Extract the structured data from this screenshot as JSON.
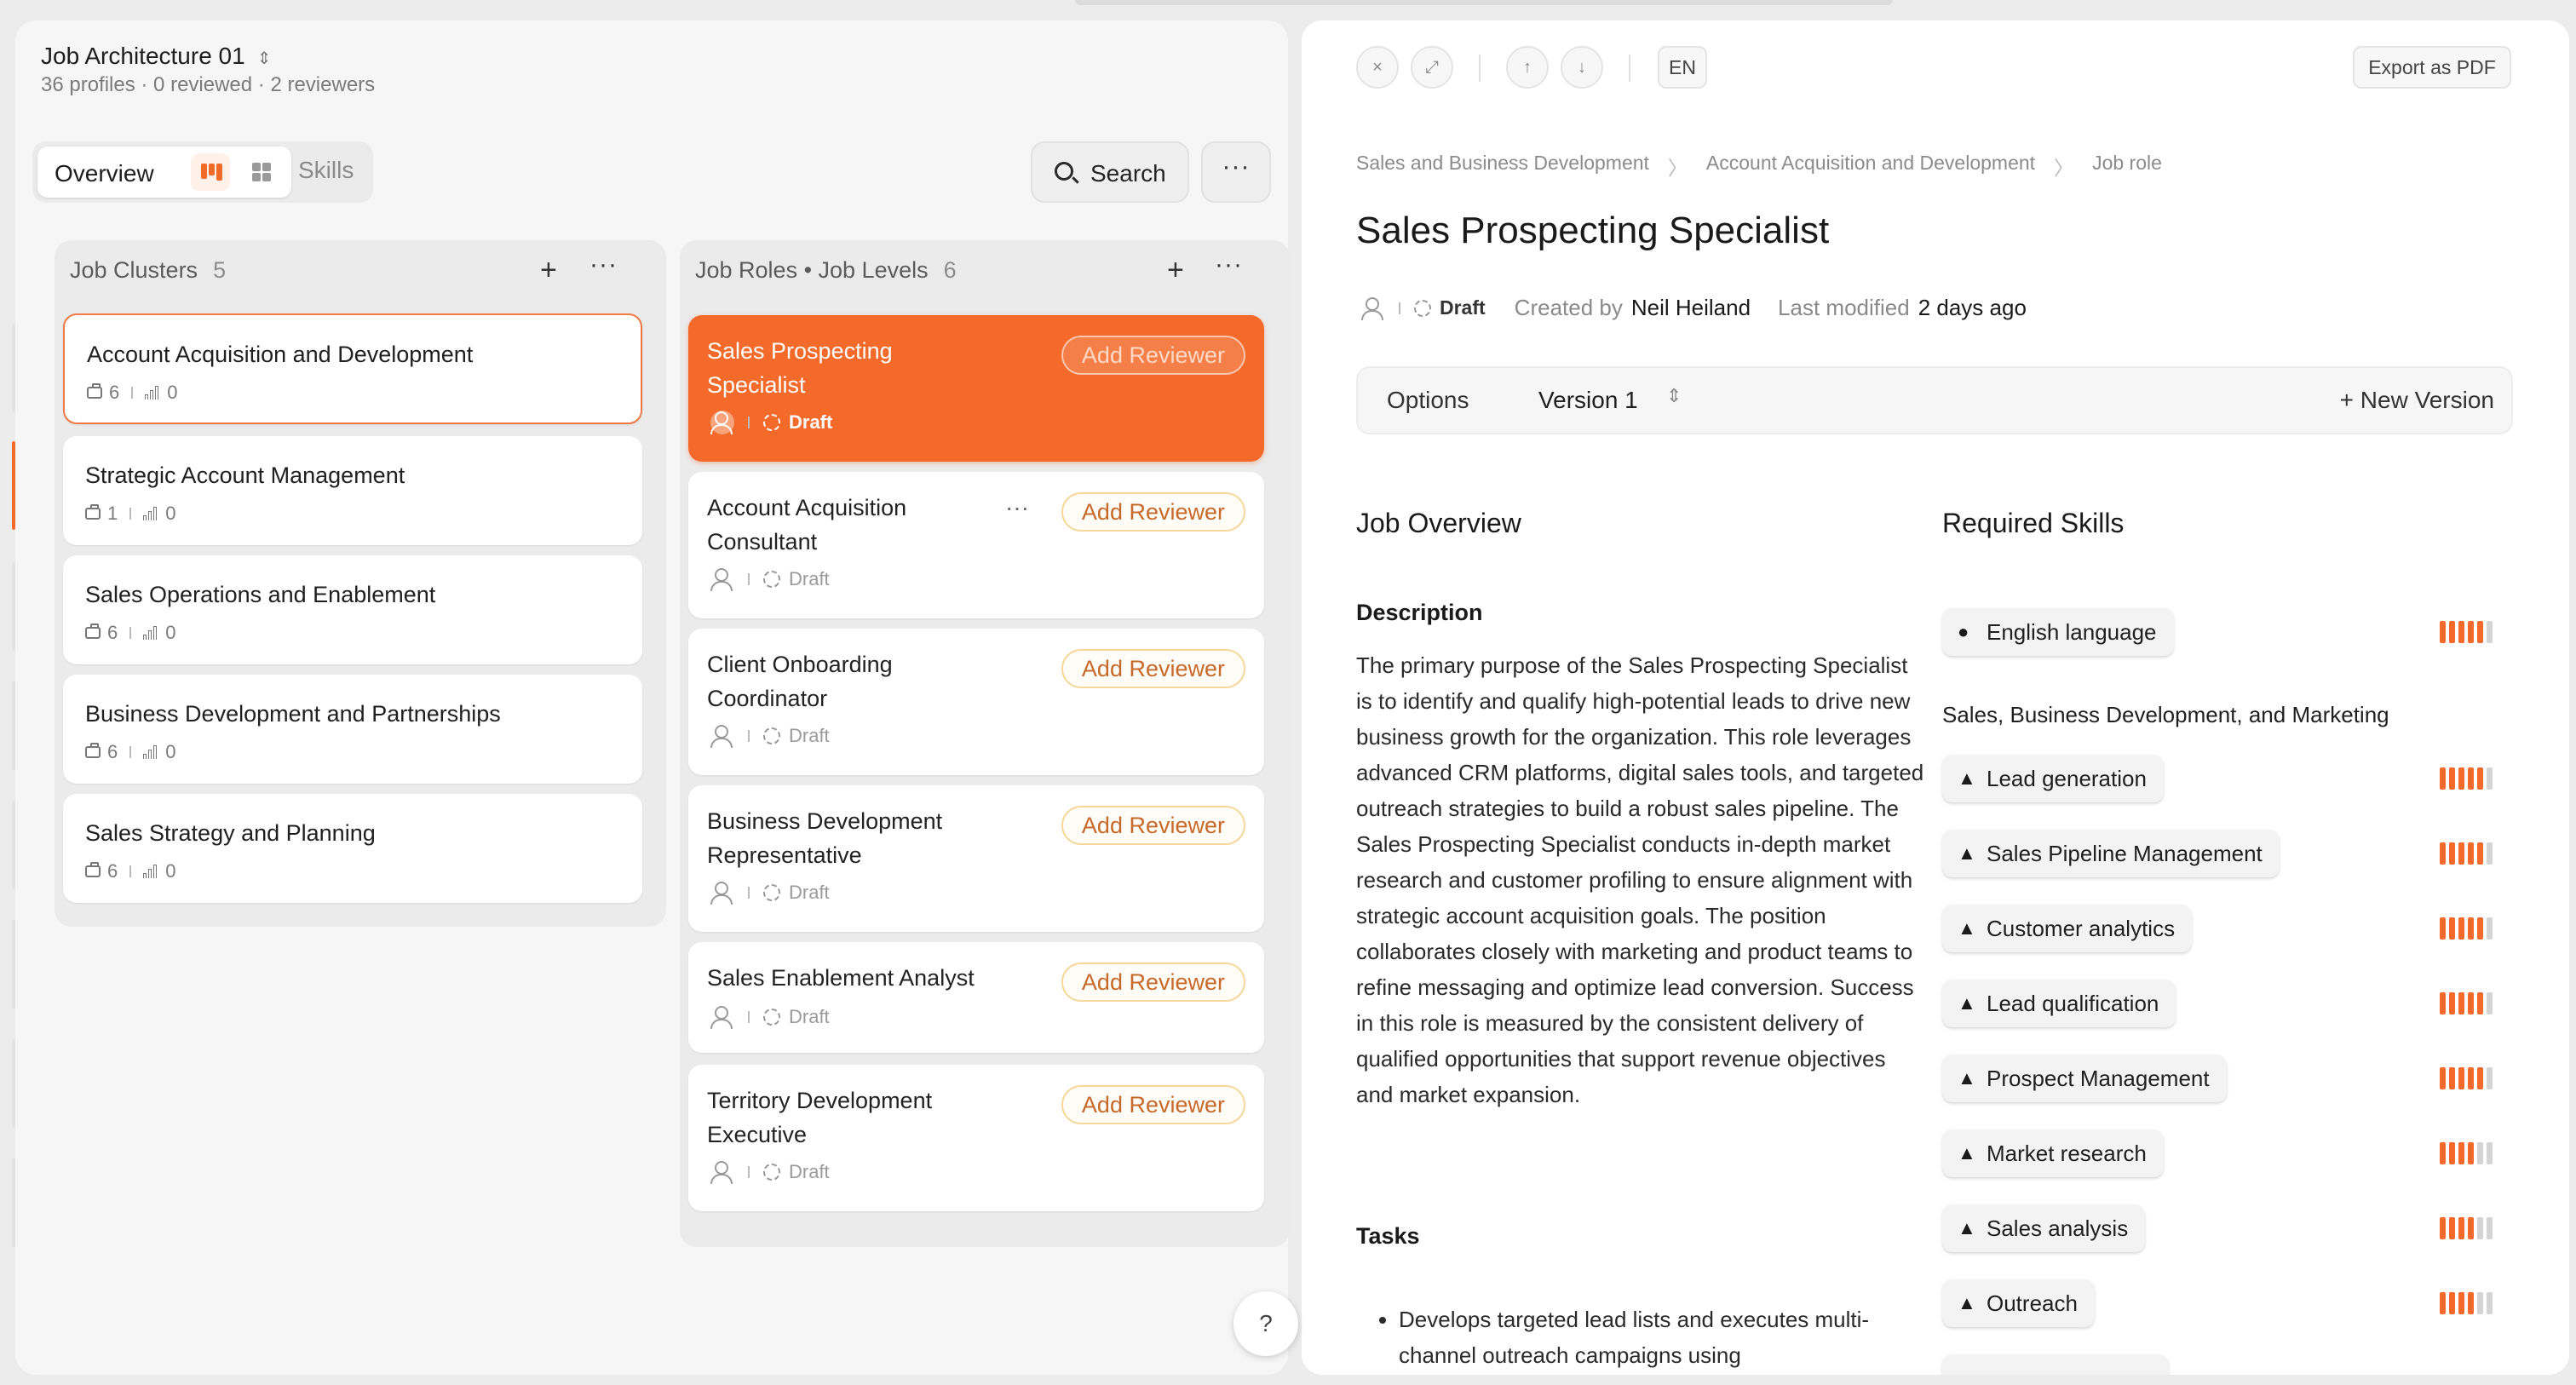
{
  "project": {
    "title": "Job Architecture 01",
    "subtitle": "36 profiles · 0 reviewed · 2 reviewers"
  },
  "view_switch": {
    "overview_label": "Overview",
    "skills_label": "Skills"
  },
  "toolbar": {
    "search_label": "Search",
    "more_label": "···"
  },
  "clusters": {
    "header": "Job Clusters",
    "count": "5",
    "items": [
      {
        "title": "Account Acquisition and Development",
        "profiles": "6",
        "reviews": "0"
      },
      {
        "title": "Strategic Account Management",
        "profiles": "1",
        "reviews": "0"
      },
      {
        "title": "Sales Operations and Enablement",
        "profiles": "6",
        "reviews": "0"
      },
      {
        "title": "Business Development and Partnerships",
        "profiles": "6",
        "reviews": "0"
      },
      {
        "title": "Sales Strategy and Planning",
        "profiles": "6",
        "reviews": "0"
      }
    ]
  },
  "roles": {
    "header": "Job Roles • Job Levels",
    "count": "6",
    "add_reviewer_label": "Add Reviewer",
    "status": "Draft",
    "items": [
      {
        "title": "Sales Prospecting Specialist"
      },
      {
        "title": "Account Acquisition Consultant"
      },
      {
        "title": "Client Onboarding Coordinator"
      },
      {
        "title": "Business Development Representative"
      },
      {
        "title": "Sales Enablement Analyst"
      },
      {
        "title": "Territory Development Executive"
      }
    ]
  },
  "detail": {
    "lang": "EN",
    "export_label": "Export as PDF",
    "breadcrumb": [
      "Sales and Business Development",
      "Account Acquisition and Development",
      "Job role"
    ],
    "title": "Sales Prospecting Specialist",
    "status": "Draft",
    "created_by_label": "Created by",
    "created_by": "Neil Heiland",
    "modified_label": "Last modified",
    "modified": "2 days ago",
    "options_label": "Options",
    "version_label": "Version 1",
    "new_version_label": "+ New Version",
    "overview_heading": "Job Overview",
    "description_label": "Description",
    "description": "The primary purpose of the Sales Prospecting Specialist is to identify and qualify high-potential leads to drive new business growth for the organization. This role leverages advanced CRM platforms, digital sales tools, and targeted outreach strategies to build a robust sales pipeline. The Sales Prospecting Specialist conducts in-depth market research and customer profiling to ensure alignment with strategic account acquisition goals. The position collaborates closely with marketing and product teams to refine messaging and optimize lead conversion. Success in this role is measured by the consistent delivery of qualified opportunities that support revenue objectives and market expansion.",
    "tasks_label": "Tasks",
    "tasks": [
      "Develops targeted lead lists and executes multi-channel outreach campaigns using"
    ],
    "skills_heading": "Required Skills",
    "skill_group": "Sales, Business Development, and Marketing",
    "skills": [
      {
        "name": "English language",
        "level": 5,
        "max": 6,
        "icon": "circle-icon"
      },
      {
        "name": "Lead generation",
        "level": 5,
        "max": 6,
        "icon": "triangle-icon"
      },
      {
        "name": "Sales Pipeline Management",
        "level": 5,
        "max": 6,
        "icon": "triangle-icon"
      },
      {
        "name": "Customer analytics",
        "level": 5,
        "max": 6,
        "icon": "triangle-icon"
      },
      {
        "name": "Lead qualification",
        "level": 5,
        "max": 6,
        "icon": "triangle-icon"
      },
      {
        "name": "Prospect Management",
        "level": 5,
        "max": 6,
        "icon": "triangle-icon"
      },
      {
        "name": "Market research",
        "level": 4,
        "max": 6,
        "icon": "triangle-icon"
      },
      {
        "name": "Sales analysis",
        "level": 4,
        "max": 6,
        "icon": "triangle-icon"
      },
      {
        "name": "Outreach",
        "level": 4,
        "max": 6,
        "icon": "triangle-icon"
      }
    ],
    "help_label": "?"
  },
  "colors": {
    "accent": "#f46a2b",
    "reviewer_border": "#f7d79a",
    "level_off": "#d4d4d4"
  }
}
